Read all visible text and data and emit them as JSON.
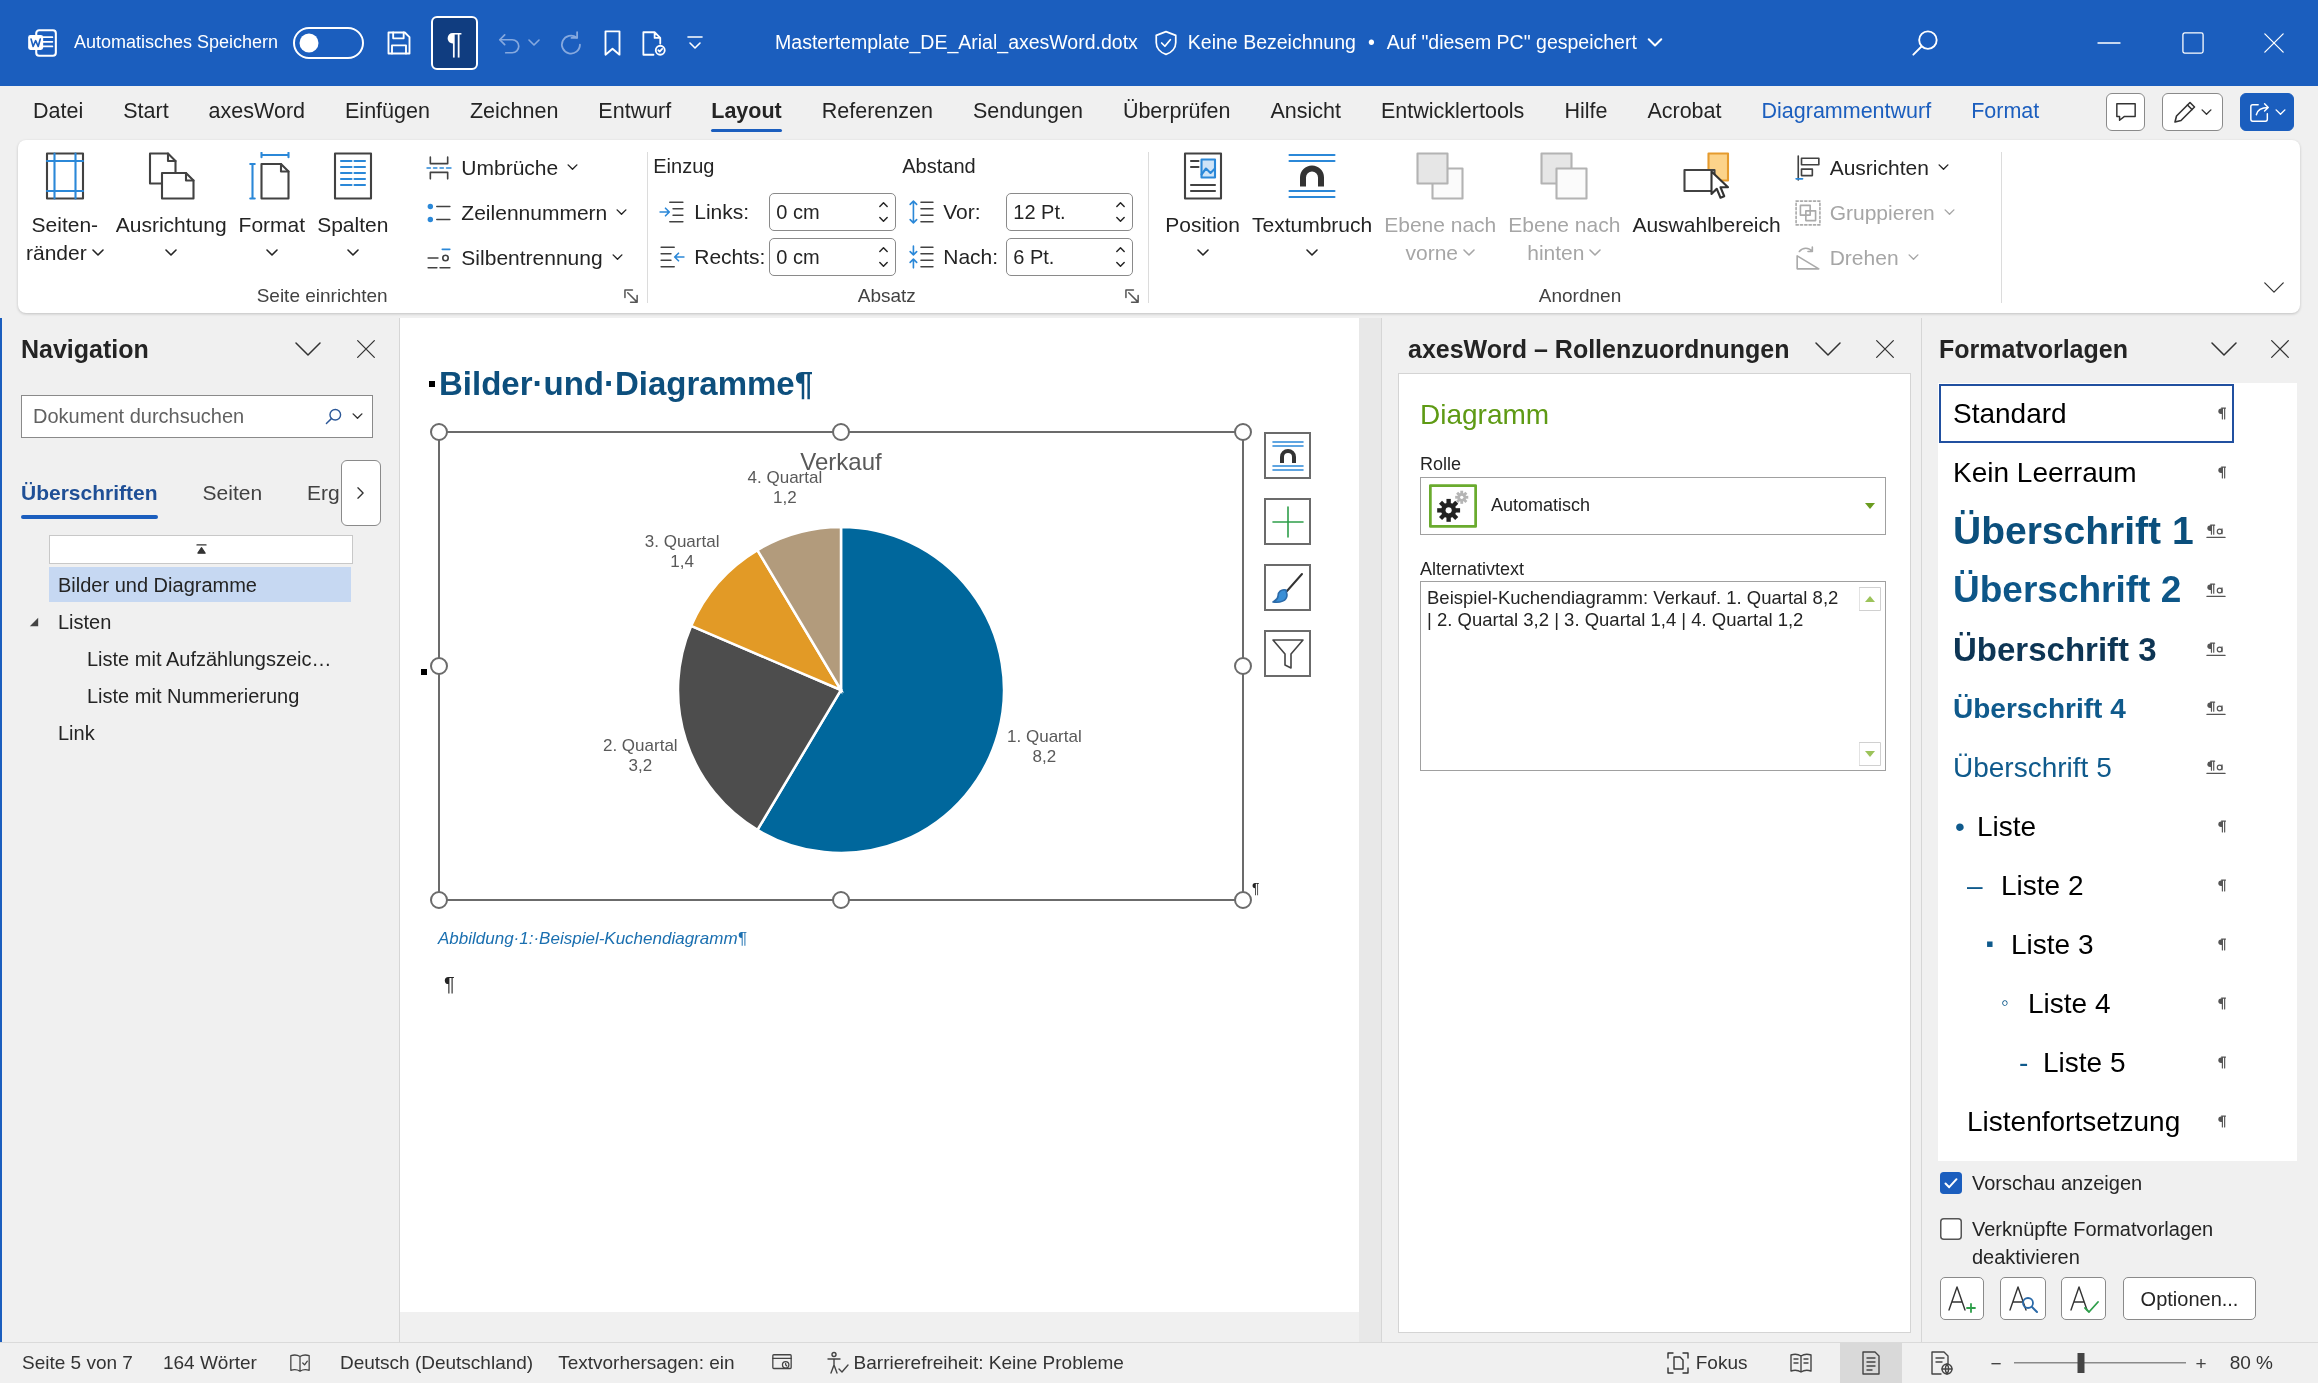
{
  "title_bar": {
    "autosave": {
      "label": "Automatisches Speichern",
      "on": false
    },
    "quick_access": [
      {
        "on": false,
        "disabled": false,
        "dropdown": false
      },
      {
        "label": "¶",
        "on": true,
        "disabled": false,
        "dropdown": false
      },
      {
        "on": false,
        "disabled": true,
        "dropdown": true
      },
      {
        "on": false,
        "disabled": true,
        "dropdown": false
      },
      {
        "on": false,
        "disabled": false,
        "dropdown": false
      },
      {
        "on": false,
        "disabled": false,
        "dropdown": false
      },
      {
        "on": false,
        "disabled": false,
        "dropdown": false
      }
    ],
    "document_title": "Mastertemplate_DE_Arial_axesWord.dotx",
    "sensitivity": "Keine Bezeichnung",
    "separator": "•",
    "save_status": "Auf \"diesem PC\" gespeichert"
  },
  "menu_tabs": [
    {
      "label": "Datei",
      "kind": "standard",
      "selected": false
    },
    {
      "label": "Start",
      "kind": "standard",
      "selected": false
    },
    {
      "label": "axesWord",
      "kind": "standard",
      "selected": false
    },
    {
      "label": "Einfügen",
      "kind": "standard",
      "selected": false
    },
    {
      "label": "Zeichnen",
      "kind": "standard",
      "selected": false
    },
    {
      "label": "Entwurf",
      "kind": "standard",
      "selected": false
    },
    {
      "label": "Layout",
      "kind": "standard",
      "selected": true
    },
    {
      "label": "Referenzen",
      "kind": "standard",
      "selected": false
    },
    {
      "label": "Sendungen",
      "kind": "standard",
      "selected": false
    },
    {
      "label": "Überprüfen",
      "kind": "standard",
      "selected": false
    },
    {
      "label": "Ansicht",
      "kind": "standard",
      "selected": false
    },
    {
      "label": "Entwicklertools",
      "kind": "standard",
      "selected": false
    },
    {
      "label": "Hilfe",
      "kind": "standard",
      "selected": false
    },
    {
      "label": "Acrobat",
      "kind": "standard",
      "selected": false
    },
    {
      "label": "Diagrammentwurf",
      "kind": "contextual",
      "selected": false
    },
    {
      "label": "Format",
      "kind": "contextual",
      "selected": false
    }
  ],
  "ribbon": {
    "groups": [
      {
        "label": "Seite einrichten",
        "kind": "buttons",
        "launcher": true,
        "large_buttons": [
          {
            "lines": [
              "Seiten-",
              "ränder"
            ],
            "dropdown": true,
            "disabled": false
          },
          {
            "lines": [
              "Ausrichtung"
            ],
            "dropdown": true,
            "disabled": false
          },
          {
            "lines": [
              "Format"
            ],
            "dropdown": true,
            "disabled": false
          },
          {
            "lines": [
              "Spalten"
            ],
            "dropdown": true,
            "disabled": false
          }
        ],
        "small_buttons": [
          {
            "label": "Umbrüche",
            "dropdown": true,
            "disabled": false
          },
          {
            "label": "Zeilennummern",
            "dropdown": true,
            "disabled": false
          },
          {
            "label": "Silbentrennung",
            "dropdown": true,
            "disabled": false
          }
        ]
      },
      {
        "label": "Absatz",
        "kind": "fields",
        "launcher": true,
        "columns": [
          {
            "heading": "Einzug",
            "fields": [
              {
                "label": "Links:",
                "value": "0 cm"
              },
              {
                "label": "Rechts:",
                "value": "0 cm"
              }
            ]
          },
          {
            "heading": "Abstand",
            "fields": [
              {
                "label": "Vor:",
                "value": "12 Pt."
              },
              {
                "label": "Nach:",
                "value": "6 Pt."
              }
            ]
          }
        ]
      },
      {
        "label": "Anordnen",
        "kind": "buttons",
        "launcher": false,
        "large_buttons": [
          {
            "lines": [
              "Position"
            ],
            "dropdown": true,
            "disabled": false
          },
          {
            "lines": [
              "Textumbruch"
            ],
            "dropdown": true,
            "disabled": false
          },
          {
            "lines": [
              "Ebene nach",
              "vorne"
            ],
            "dropdown": true,
            "disabled": true
          },
          {
            "lines": [
              "Ebene nach",
              "hinten"
            ],
            "dropdown": true,
            "disabled": true
          },
          {
            "lines": [
              "Auswahlbereich"
            ],
            "dropdown": false,
            "disabled": false
          }
        ],
        "small_buttons": [
          {
            "label": "Ausrichten",
            "dropdown": true,
            "disabled": false
          },
          {
            "label": "Gruppieren",
            "dropdown": true,
            "disabled": true
          },
          {
            "label": "Drehen",
            "dropdown": true,
            "disabled": true
          }
        ]
      }
    ]
  },
  "navigation": {
    "title": "Navigation",
    "search_placeholder": "Dokument durchsuchen",
    "tabs": [
      {
        "label": "Überschriften",
        "selected": true
      },
      {
        "label": "Seiten",
        "selected": false
      },
      {
        "label": "Erg",
        "selected": false
      }
    ],
    "headings": [
      {
        "text": "Bilder und Diagramme",
        "selected": true
      },
      {
        "text": "Listen",
        "selected": false,
        "expanded": true,
        "children": [
          {
            "text": "Liste mit Aufzählungszeic…",
            "selected": false
          },
          {
            "text": "Liste mit Nummerierung",
            "selected": false
          }
        ]
      },
      {
        "text": "Link",
        "selected": false
      }
    ]
  },
  "document": {
    "heading": "Bilder·und·Diagramme¶",
    "chart": {
      "chart_data": {
        "type": "pie",
        "title": "Verkauf",
        "categories": [
          "1. Quartal",
          "2. Quartal",
          "3. Quartal",
          "4. Quartal"
        ],
        "values": [
          8.2,
          3.2,
          1.4,
          1.2
        ],
        "value_labels": [
          "8,2",
          "3,2",
          "1,4",
          "1,2"
        ]
      },
      "paragraph_mark": "¶"
    },
    "caption": "Abbildung·1:·Beispiel-Kuchendiagramm¶",
    "empty_paragraph": "¶"
  },
  "role_pane": {
    "title": "axesWord – Rollenzuordnungen",
    "section": "Diagramm",
    "role_label": "Rolle",
    "role_value": "Automatisch",
    "alt_text_label": "Alternativtext",
    "alt_text": "Beispiel-Kuchendiagramm: Verkauf. 1. Quartal 8,2 | 2. Quartal 3,2 | 3. Quartal 1,4 | 4. Quartal 1,2"
  },
  "styles_pane": {
    "title": "Formatvorlagen",
    "styles": [
      {
        "name": "Standard",
        "kind": "normal",
        "selected": true
      },
      {
        "name": "Kein Leerraum",
        "kind": "normal",
        "selected": false
      },
      {
        "name": "Überschrift 1",
        "kind": "heading1",
        "selected": false
      },
      {
        "name": "Überschrift 2",
        "kind": "heading2",
        "selected": false
      },
      {
        "name": "Überschrift 3",
        "kind": "heading3",
        "selected": false
      },
      {
        "name": "Überschrift 4",
        "kind": "heading4",
        "selected": false
      },
      {
        "name": "Überschrift 5",
        "kind": "heading5",
        "selected": false
      },
      {
        "name": "Liste",
        "kind": "list1",
        "bullet": "•",
        "selected": false
      },
      {
        "name": "Liste 2",
        "kind": "list2",
        "bullet": "–",
        "selected": false
      },
      {
        "name": "Liste 3",
        "kind": "list3",
        "bullet": "▪",
        "selected": false
      },
      {
        "name": "Liste 4",
        "kind": "list4",
        "bullet": "◦",
        "selected": false
      },
      {
        "name": "Liste 5",
        "kind": "list5",
        "bullet": "-",
        "selected": false
      },
      {
        "name": "Listenfortsetzung",
        "kind": "list_continue",
        "selected": false
      }
    ],
    "checkboxes": [
      {
        "label": "Vorschau anzeigen",
        "checked": true
      },
      {
        "label": "Verknüpfte Formatvorlagen deaktivieren",
        "checked": false
      }
    ],
    "options_button": "Optionen..."
  },
  "status_bar": {
    "page": "Seite 5 von 7",
    "words": "164 Wörter",
    "language": "Deutsch (Deutschland)",
    "text_predictions": "Textvorhersagen: ein",
    "accessibility": "Barrierefreiheit: Keine Probleme",
    "focus": "Fokus",
    "views": [
      {
        "selected": false
      },
      {
        "selected": true
      },
      {
        "selected": false
      }
    ],
    "zoom": {
      "minus": "−",
      "plus": "+",
      "level": 0.39,
      "reading": "80 %"
    }
  }
}
